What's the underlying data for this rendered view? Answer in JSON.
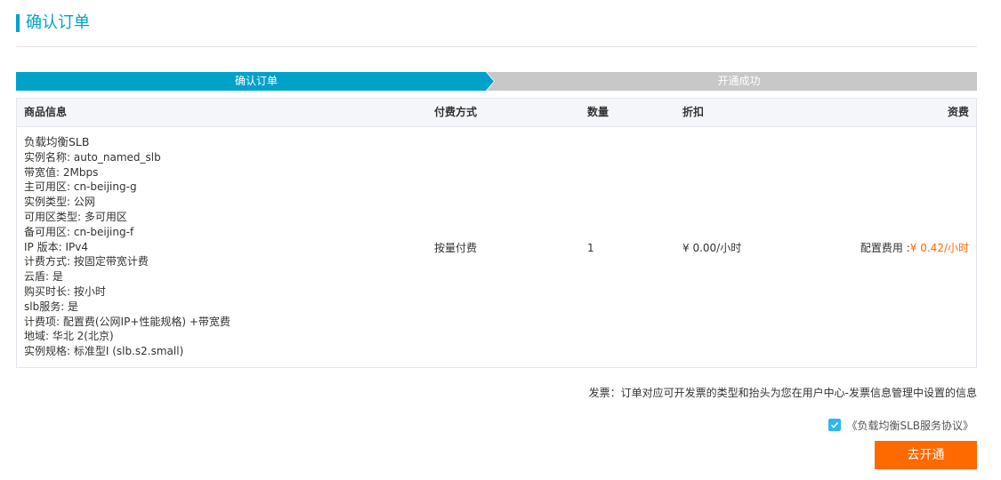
{
  "page": {
    "title": "确认订单"
  },
  "steps": [
    {
      "label": "确认订单",
      "state": "active",
      "color": "#00a2ca"
    },
    {
      "label": "开通成功",
      "state": "inactive",
      "color": "#c8c8c8"
    }
  ],
  "table": {
    "headers": {
      "product": "商品信息",
      "pay_method": "付费方式",
      "quantity": "数量",
      "discount": "折扣",
      "price": "资费"
    },
    "row": {
      "product_name": "负载均衡SLB",
      "details": [
        "实例名称: auto_named_slb",
        "带宽值: 2Mbps",
        "主可用区: cn-beijing-g",
        "实例类型: 公网",
        "可用区类型: 多可用区",
        "备可用区: cn-beijing-f",
        "IP 版本: IPv4",
        "计费方式: 按固定带宽计费",
        "云盾: 是",
        "购买时长: 按小时",
        "slb服务: 是",
        "计费项: 配置费(公网IP+性能规格) +带宽费",
        "地域: 华北 2(北京)",
        "实例规格: 标准型I (slb.s2.small)"
      ],
      "pay_method": "按量付费",
      "quantity": "1",
      "discount": "¥ 0.00/小时",
      "price_label": "配置费用 :",
      "price_value": "¥ 0.42/小时"
    }
  },
  "invoice_note": "发票：订单对应可开发票的类型和抬头为您在用户中心-发票信息管理中设置的信息",
  "agreement": {
    "checked": true,
    "label": "《负载均衡SLB服务协议》"
  },
  "submit_button": {
    "label": "去开通",
    "color": "#ff6a00"
  },
  "colors": {
    "accent": "#00a2ca",
    "price": "#ff6a00",
    "checkbox": "#2db7f5"
  }
}
